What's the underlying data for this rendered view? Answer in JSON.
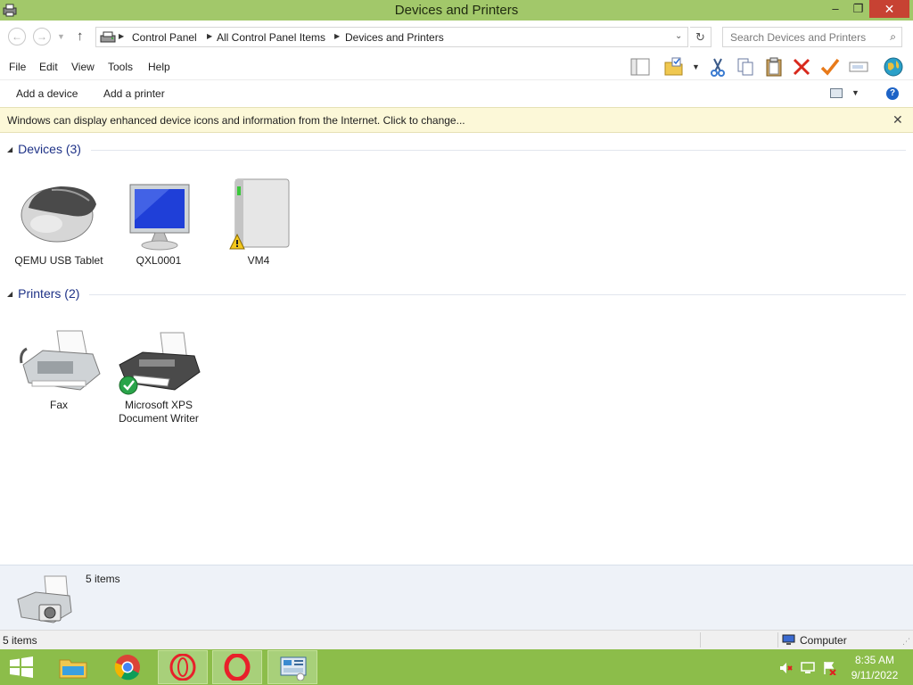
{
  "window": {
    "title": "Devices and Printers",
    "controls": {
      "minimize": "–",
      "maximize": "❐",
      "close": "✕"
    }
  },
  "address_bar": {
    "breadcrumbs": [
      "Control Panel",
      "All Control Panel Items",
      "Devices and Printers"
    ],
    "search_placeholder": "Search Devices and Printers"
  },
  "menu": [
    "File",
    "Edit",
    "View",
    "Tools",
    "Help"
  ],
  "toolbar_icons": [
    "layout-pane-icon",
    "folder-properties-icon",
    "cut-icon",
    "copy-icon",
    "paste-icon",
    "delete-icon",
    "checkmark-icon",
    "rename-icon",
    "globe-icon"
  ],
  "commands": {
    "add_device": "Add a device",
    "add_printer": "Add a printer"
  },
  "infobar": {
    "message": "Windows can display enhanced device icons and information from the Internet. Click to change..."
  },
  "groups": {
    "devices": {
      "title": "Devices (3)",
      "items": [
        {
          "label": "QEMU USB Tablet",
          "icon": "mouse-icon"
        },
        {
          "label": "QXL0001",
          "icon": "monitor-icon"
        },
        {
          "label": "VM4",
          "icon": "external-drive-warning-icon"
        }
      ]
    },
    "printers": {
      "title": "Printers (2)",
      "items": [
        {
          "label": "Fax",
          "icon": "fax-icon"
        },
        {
          "label": "Microsoft XPS Document Writer",
          "icon": "printer-default-icon"
        }
      ]
    }
  },
  "details": {
    "count": "5 items"
  },
  "status": {
    "left": "5 items",
    "right": "Computer"
  },
  "taskbar": {
    "apps": [
      "start-icon",
      "file-explorer-icon",
      "chrome-icon",
      "opera-icon",
      "opera-icon",
      "control-panel-icon"
    ],
    "time": "8:35 AM",
    "date": "9/11/2022"
  },
  "colors": {
    "titlebar": "#a2c86a",
    "taskbar": "#8cbd4a",
    "group_heading": "#1e3287",
    "infobar": "#fcf8d8"
  }
}
